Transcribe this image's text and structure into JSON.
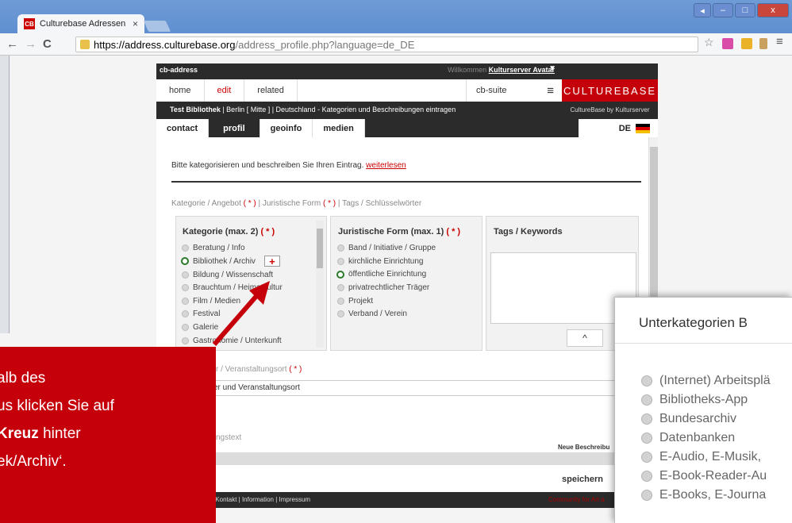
{
  "browser": {
    "tab_title": "Culturebase Adressen",
    "tab_close": "×",
    "favicon_text": "CB",
    "url_host": "https://address.culturebase.org",
    "url_path": "/address_profile.php?language=de_DE",
    "back": "←",
    "forward": "→",
    "reload": "C",
    "menu": "≡",
    "star": "☆"
  },
  "site": {
    "app_name": "cb-address",
    "welcome_prefix": "Willkommen",
    "welcome_user": "Kulturserver Avatar",
    "caret": "▼",
    "nav": [
      "home",
      "edit",
      "related"
    ],
    "suite": "cb-suite",
    "hamburger": "≡",
    "brand": "CULTUREBASE",
    "brand_sub": "CultureBase by Kulturserver",
    "breadcrumb_bold": "Test Bibliothek",
    "breadcrumb_rest": " | Berlin [ Mitte ] | Deutschland - Kategorien und Beschreibungen eintragen",
    "subtabs": [
      "contact",
      "profil",
      "geoinfo",
      "medien"
    ],
    "lang": "DE",
    "accent": "#c4000a"
  },
  "form": {
    "intro": "Bitte kategorisieren und beschreiben Sie Ihren Eintrag.",
    "intro_link": "weiterlesen",
    "section_a": "Kategorie / Angebot",
    "section_b": " | Juristische Form ",
    "section_c": " | Tags / Schlüsselwörter",
    "req": "( * )",
    "kategorie_title": "Kategorie (max. 2)",
    "kategorie_items": [
      "Beratung / Info",
      "Bibliothek / Archiv",
      "Bildung / Wissenschaft",
      "Brauchtum / Heimatkultur",
      "Film / Medien",
      "Festival",
      "Galerie",
      "Gastronomie / Unterkunft"
    ],
    "plus": "+",
    "juristisch_title": "Juristische Form (max. 1)",
    "juristisch_items": [
      "Band / Initiative / Gruppe",
      "kirchliche Einrichtung",
      "öffentliche Einrichtung",
      "privatrechtlicher Träger",
      "Projekt",
      "Verband / Verein"
    ],
    "tags_title": "Tags / Keywords",
    "up": "^",
    "veranstalter_label": "r / Veranstaltungsort",
    "veranstalter_value": "er und Veranstaltungsort",
    "beschreibung_label": "ngstext",
    "neue_beschreibung": "Neue Beschreibu",
    "save": "speichern",
    "footer_links": "| Kontakt | Information | Impressum",
    "footer_comm": "Community for Art a"
  },
  "callout": {
    "line1": "alb des",
    "line2": "us klicken Sie auf",
    "line3_bold": "Kreuz",
    "line3_rest": " hinter",
    "line4": "ek/Archiv‘."
  },
  "popup": {
    "title": "Unterkategorien B",
    "items": [
      "(Internet) Arbeitsplä",
      "Bibliotheks-App",
      "Bundesarchiv",
      "Datenbanken",
      "E-Audio, E-Musik,",
      "E-Book-Reader-Au",
      "E-Books, E-Journa"
    ]
  }
}
